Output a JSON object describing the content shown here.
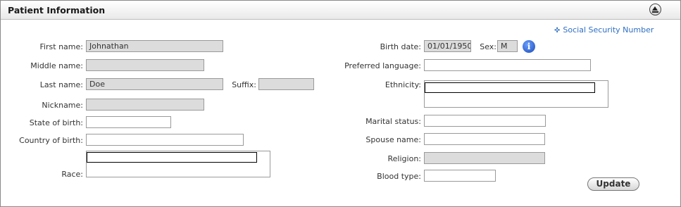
{
  "header": {
    "title": "Patient Information"
  },
  "ssn_link": "Social Security Number",
  "left": {
    "first_name": {
      "label": "First name:",
      "value": "Johnathan"
    },
    "middle_name": {
      "label": "Middle name:",
      "value": ""
    },
    "last_name": {
      "label": "Last name:",
      "value": "Doe"
    },
    "suffix": {
      "label": "Suffix:",
      "value": ""
    },
    "nickname": {
      "label": "Nickname:",
      "value": ""
    },
    "state_of_birth": {
      "label": "State of birth:",
      "value": ""
    },
    "country_of_birth": {
      "label": "Country of birth:",
      "value": ""
    },
    "race": {
      "label": "Race:"
    }
  },
  "right": {
    "birth_date": {
      "label": "Birth date:",
      "value": "01/01/1950"
    },
    "sex": {
      "label": "Sex:",
      "value": "M"
    },
    "preferred_language": {
      "label": "Preferred language:",
      "value": ""
    },
    "ethnicity": {
      "label": "Ethnicity:"
    },
    "marital_status": {
      "label": "Marital status:",
      "value": ""
    },
    "spouse_name": {
      "label": "Spouse name:",
      "value": ""
    },
    "religion": {
      "label": "Religion:",
      "value": ""
    },
    "blood_type": {
      "label": "Blood type:",
      "value": ""
    }
  },
  "update_button": "Update",
  "info_icon_glyph": "i"
}
